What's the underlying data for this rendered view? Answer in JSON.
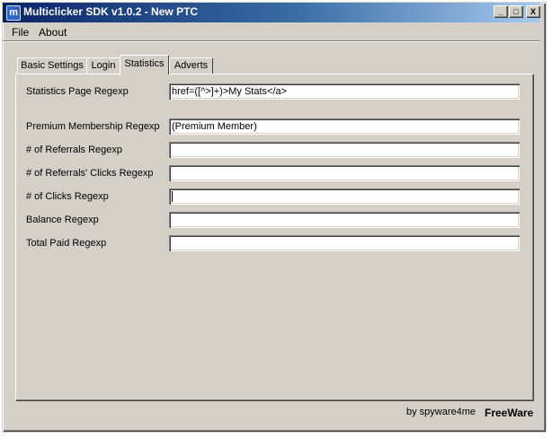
{
  "window": {
    "title": "Multiclicker SDK v1.0.2 - New PTC",
    "icon_letter": "m"
  },
  "title_buttons": {
    "minimize": "_",
    "maximize": "□",
    "close": "X"
  },
  "menu": [
    "File",
    "About"
  ],
  "tabs": [
    {
      "label": "Basic Settings",
      "active": false
    },
    {
      "label": "Login",
      "active": false
    },
    {
      "label": "Statistics",
      "active": true
    },
    {
      "label": "Adverts",
      "active": false
    }
  ],
  "statistics": {
    "fields": [
      {
        "label": "Statistics Page Regexp",
        "value": "href=([^>]+)>My Stats</a>"
      },
      {
        "label": "Premium Membership Regexp",
        "value": "(Premium Member)"
      },
      {
        "label": "# of Referrals Regexp",
        "value": ""
      },
      {
        "label": "# of Referrals' Clicks Regexp",
        "value": ""
      },
      {
        "label": "# of Clicks Regexp",
        "value": ""
      },
      {
        "label": "Balance Regexp",
        "value": ""
      },
      {
        "label": "Total Paid Regexp",
        "value": ""
      }
    ]
  },
  "footer": {
    "credit": "by spyware4me",
    "license": "FreeWare"
  }
}
